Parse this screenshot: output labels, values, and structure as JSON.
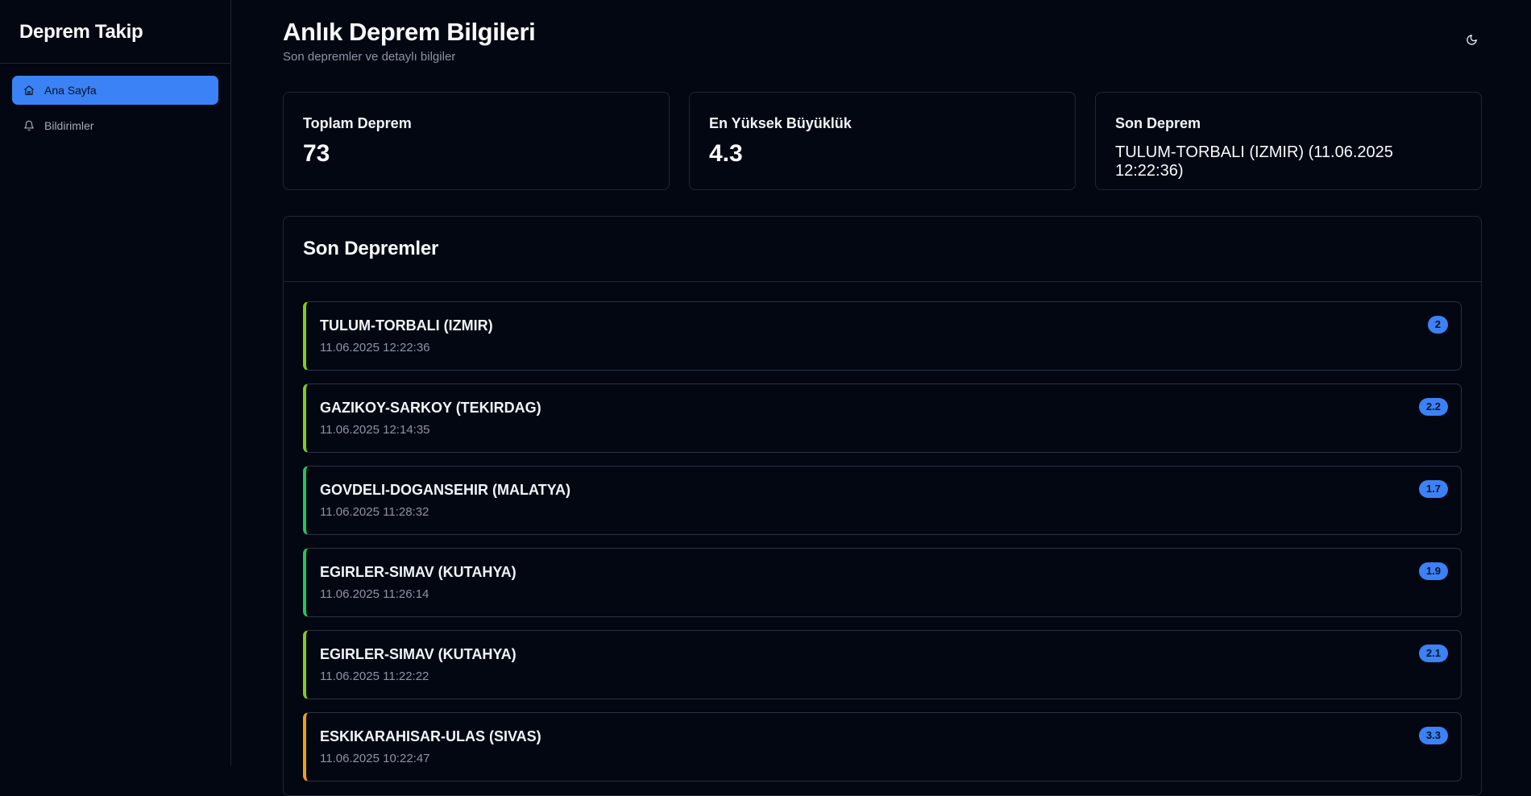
{
  "sidebar": {
    "brand": "Deprem Takip",
    "items": [
      {
        "label": "Ana Sayfa",
        "icon": "home-icon",
        "active": true
      },
      {
        "label": "Bildirimler",
        "icon": "bell-icon",
        "active": false
      }
    ]
  },
  "header": {
    "title": "Anlık Deprem Bilgileri",
    "subtitle": "Son depremler ve detaylı bilgiler",
    "theme_icon": "moon-icon"
  },
  "stats": [
    {
      "label": "Toplam Deprem",
      "value": "73"
    },
    {
      "label": "En Yüksek Büyüklük",
      "value": "4.3"
    },
    {
      "label": "Son Deprem",
      "value": "TULUM-TORBALI (IZMIR) (11.06.2025 12:22:36)"
    }
  ],
  "quakes": {
    "title": "Son Depremler",
    "items": [
      {
        "location": "TULUM-TORBALI (IZMIR)",
        "time": "11.06.2025 12:22:36",
        "magnitude": "2",
        "color": "#84cc16"
      },
      {
        "location": "GAZIKOY-SARKOY (TEKIRDAG)",
        "time": "11.06.2025 12:14:35",
        "magnitude": "2.2",
        "color": "#84cc16"
      },
      {
        "location": "GOVDELI-DOGANSEHIR (MALATYA)",
        "time": "11.06.2025 11:28:32",
        "magnitude": "1.7",
        "color": "#22c55e"
      },
      {
        "location": "EGIRLER-SIMAV (KUTAHYA)",
        "time": "11.06.2025 11:26:14",
        "magnitude": "1.9",
        "color": "#22c55e"
      },
      {
        "location": "EGIRLER-SIMAV (KUTAHYA)",
        "time": "11.06.2025 11:22:22",
        "magnitude": "2.1",
        "color": "#84cc16"
      },
      {
        "location": "ESKIKARAHISAR-ULAS (SIVAS)",
        "time": "11.06.2025 10:22:47",
        "magnitude": "3.3",
        "color": "#f59e0b"
      }
    ]
  },
  "colors": {
    "accent": "#3b82f6",
    "background": "#030712",
    "border": "#1f2735"
  }
}
